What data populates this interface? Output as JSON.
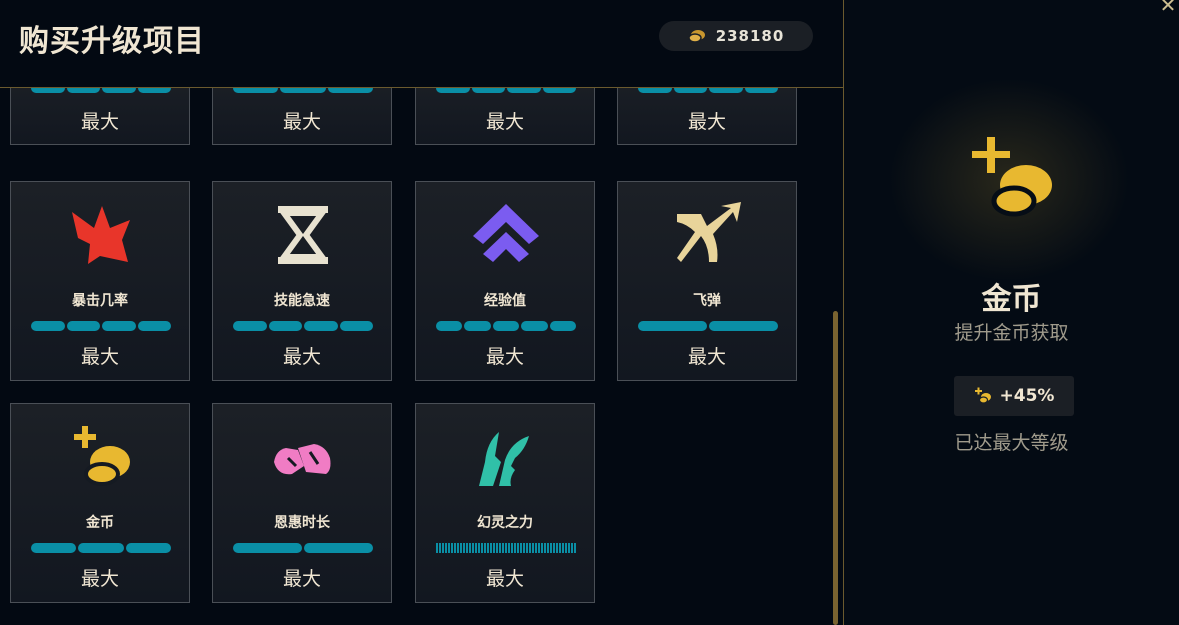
{
  "header": {
    "title": "购买升级项目",
    "currency_amount": "238180"
  },
  "cards_top": [
    {
      "segments": 4,
      "level": "最大"
    },
    {
      "segments": 3,
      "level": "最大"
    },
    {
      "segments": 4,
      "level": "最大"
    },
    {
      "segments": 4,
      "level": "最大"
    }
  ],
  "cards": [
    {
      "name": "暴击几率",
      "segments": 4,
      "level": "最大",
      "icon": "crit-icon",
      "color": "#e8352a"
    },
    {
      "name": "技能急速",
      "segments": 4,
      "level": "最大",
      "icon": "hourglass-icon",
      "color": "#e8e2d0"
    },
    {
      "name": "经验值",
      "segments": 5,
      "level": "最大",
      "icon": "double-chevron-up-icon",
      "color": "#7b5cf0"
    },
    {
      "name": "飞弹",
      "segments": 2,
      "level": "最大",
      "icon": "projectile-arrows-icon",
      "color": "#e8d49a"
    },
    {
      "name": "金币",
      "segments": 3,
      "level": "最大",
      "icon": "gold-plus-icon",
      "color": "#e8b830"
    },
    {
      "name": "恩惠时长",
      "segments": 2,
      "level": "最大",
      "icon": "boon-duration-icon",
      "color": "#f07cc4"
    },
    {
      "name": "幻灵之力",
      "segments": 1,
      "striped": true,
      "level": "最大",
      "icon": "spirit-power-icon",
      "color": "#30c0a8"
    }
  ],
  "detail": {
    "title": "金币",
    "description": "提升金币获取",
    "stat_value": "+45%",
    "status": "已达最大等级"
  },
  "colors": {
    "accent_gold": "#cdbe91",
    "bar_teal": "#0a8fa6",
    "background": "#030912"
  }
}
